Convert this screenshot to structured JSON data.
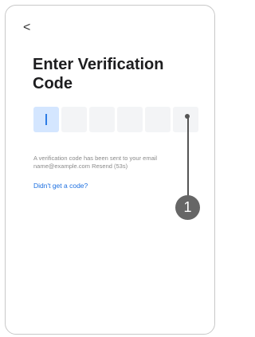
{
  "nav": {
    "back_glyph": "<",
    "back_icon": "chevron-left-icon"
  },
  "title": "Enter Verification Code",
  "code": {
    "length": 6,
    "active_index": 0,
    "digits": [
      "",
      "",
      "",
      "",
      "",
      ""
    ]
  },
  "info": {
    "message": "A verification code has been sent to your email",
    "email": "name@example.com",
    "resend": "Resend (53s)"
  },
  "help_link": "Didn't get a code?",
  "annotation": {
    "number": "1"
  },
  "colors": {
    "accent": "#1c6fe0",
    "active_box": "#d4e6ff",
    "box": "#f3f4f6",
    "badge": "#666666"
  }
}
